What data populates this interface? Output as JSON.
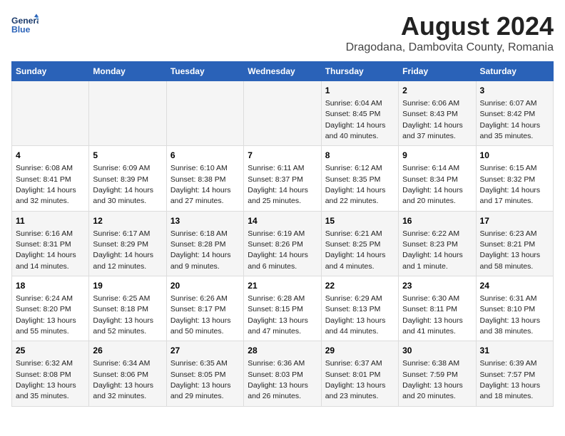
{
  "header": {
    "logo_line1": "General",
    "logo_line2": "Blue",
    "title": "August 2024",
    "subtitle": "Dragodana, Dambovita County, Romania"
  },
  "weekdays": [
    "Sunday",
    "Monday",
    "Tuesday",
    "Wednesday",
    "Thursday",
    "Friday",
    "Saturday"
  ],
  "weeks": [
    [
      {
        "day": "",
        "text": ""
      },
      {
        "day": "",
        "text": ""
      },
      {
        "day": "",
        "text": ""
      },
      {
        "day": "",
        "text": ""
      },
      {
        "day": "1",
        "text": "Sunrise: 6:04 AM\nSunset: 8:45 PM\nDaylight: 14 hours\nand 40 minutes."
      },
      {
        "day": "2",
        "text": "Sunrise: 6:06 AM\nSunset: 8:43 PM\nDaylight: 14 hours\nand 37 minutes."
      },
      {
        "day": "3",
        "text": "Sunrise: 6:07 AM\nSunset: 8:42 PM\nDaylight: 14 hours\nand 35 minutes."
      }
    ],
    [
      {
        "day": "4",
        "text": "Sunrise: 6:08 AM\nSunset: 8:41 PM\nDaylight: 14 hours\nand 32 minutes."
      },
      {
        "day": "5",
        "text": "Sunrise: 6:09 AM\nSunset: 8:39 PM\nDaylight: 14 hours\nand 30 minutes."
      },
      {
        "day": "6",
        "text": "Sunrise: 6:10 AM\nSunset: 8:38 PM\nDaylight: 14 hours\nand 27 minutes."
      },
      {
        "day": "7",
        "text": "Sunrise: 6:11 AM\nSunset: 8:37 PM\nDaylight: 14 hours\nand 25 minutes."
      },
      {
        "day": "8",
        "text": "Sunrise: 6:12 AM\nSunset: 8:35 PM\nDaylight: 14 hours\nand 22 minutes."
      },
      {
        "day": "9",
        "text": "Sunrise: 6:14 AM\nSunset: 8:34 PM\nDaylight: 14 hours\nand 20 minutes."
      },
      {
        "day": "10",
        "text": "Sunrise: 6:15 AM\nSunset: 8:32 PM\nDaylight: 14 hours\nand 17 minutes."
      }
    ],
    [
      {
        "day": "11",
        "text": "Sunrise: 6:16 AM\nSunset: 8:31 PM\nDaylight: 14 hours\nand 14 minutes."
      },
      {
        "day": "12",
        "text": "Sunrise: 6:17 AM\nSunset: 8:29 PM\nDaylight: 14 hours\nand 12 minutes."
      },
      {
        "day": "13",
        "text": "Sunrise: 6:18 AM\nSunset: 8:28 PM\nDaylight: 14 hours\nand 9 minutes."
      },
      {
        "day": "14",
        "text": "Sunrise: 6:19 AM\nSunset: 8:26 PM\nDaylight: 14 hours\nand 6 minutes."
      },
      {
        "day": "15",
        "text": "Sunrise: 6:21 AM\nSunset: 8:25 PM\nDaylight: 14 hours\nand 4 minutes."
      },
      {
        "day": "16",
        "text": "Sunrise: 6:22 AM\nSunset: 8:23 PM\nDaylight: 14 hours\nand 1 minute."
      },
      {
        "day": "17",
        "text": "Sunrise: 6:23 AM\nSunset: 8:21 PM\nDaylight: 13 hours\nand 58 minutes."
      }
    ],
    [
      {
        "day": "18",
        "text": "Sunrise: 6:24 AM\nSunset: 8:20 PM\nDaylight: 13 hours\nand 55 minutes."
      },
      {
        "day": "19",
        "text": "Sunrise: 6:25 AM\nSunset: 8:18 PM\nDaylight: 13 hours\nand 52 minutes."
      },
      {
        "day": "20",
        "text": "Sunrise: 6:26 AM\nSunset: 8:17 PM\nDaylight: 13 hours\nand 50 minutes."
      },
      {
        "day": "21",
        "text": "Sunrise: 6:28 AM\nSunset: 8:15 PM\nDaylight: 13 hours\nand 47 minutes."
      },
      {
        "day": "22",
        "text": "Sunrise: 6:29 AM\nSunset: 8:13 PM\nDaylight: 13 hours\nand 44 minutes."
      },
      {
        "day": "23",
        "text": "Sunrise: 6:30 AM\nSunset: 8:11 PM\nDaylight: 13 hours\nand 41 minutes."
      },
      {
        "day": "24",
        "text": "Sunrise: 6:31 AM\nSunset: 8:10 PM\nDaylight: 13 hours\nand 38 minutes."
      }
    ],
    [
      {
        "day": "25",
        "text": "Sunrise: 6:32 AM\nSunset: 8:08 PM\nDaylight: 13 hours\nand 35 minutes."
      },
      {
        "day": "26",
        "text": "Sunrise: 6:34 AM\nSunset: 8:06 PM\nDaylight: 13 hours\nand 32 minutes."
      },
      {
        "day": "27",
        "text": "Sunrise: 6:35 AM\nSunset: 8:05 PM\nDaylight: 13 hours\nand 29 minutes."
      },
      {
        "day": "28",
        "text": "Sunrise: 6:36 AM\nSunset: 8:03 PM\nDaylight: 13 hours\nand 26 minutes."
      },
      {
        "day": "29",
        "text": "Sunrise: 6:37 AM\nSunset: 8:01 PM\nDaylight: 13 hours\nand 23 minutes."
      },
      {
        "day": "30",
        "text": "Sunrise: 6:38 AM\nSunset: 7:59 PM\nDaylight: 13 hours\nand 20 minutes."
      },
      {
        "day": "31",
        "text": "Sunrise: 6:39 AM\nSunset: 7:57 PM\nDaylight: 13 hours\nand 18 minutes."
      }
    ]
  ]
}
